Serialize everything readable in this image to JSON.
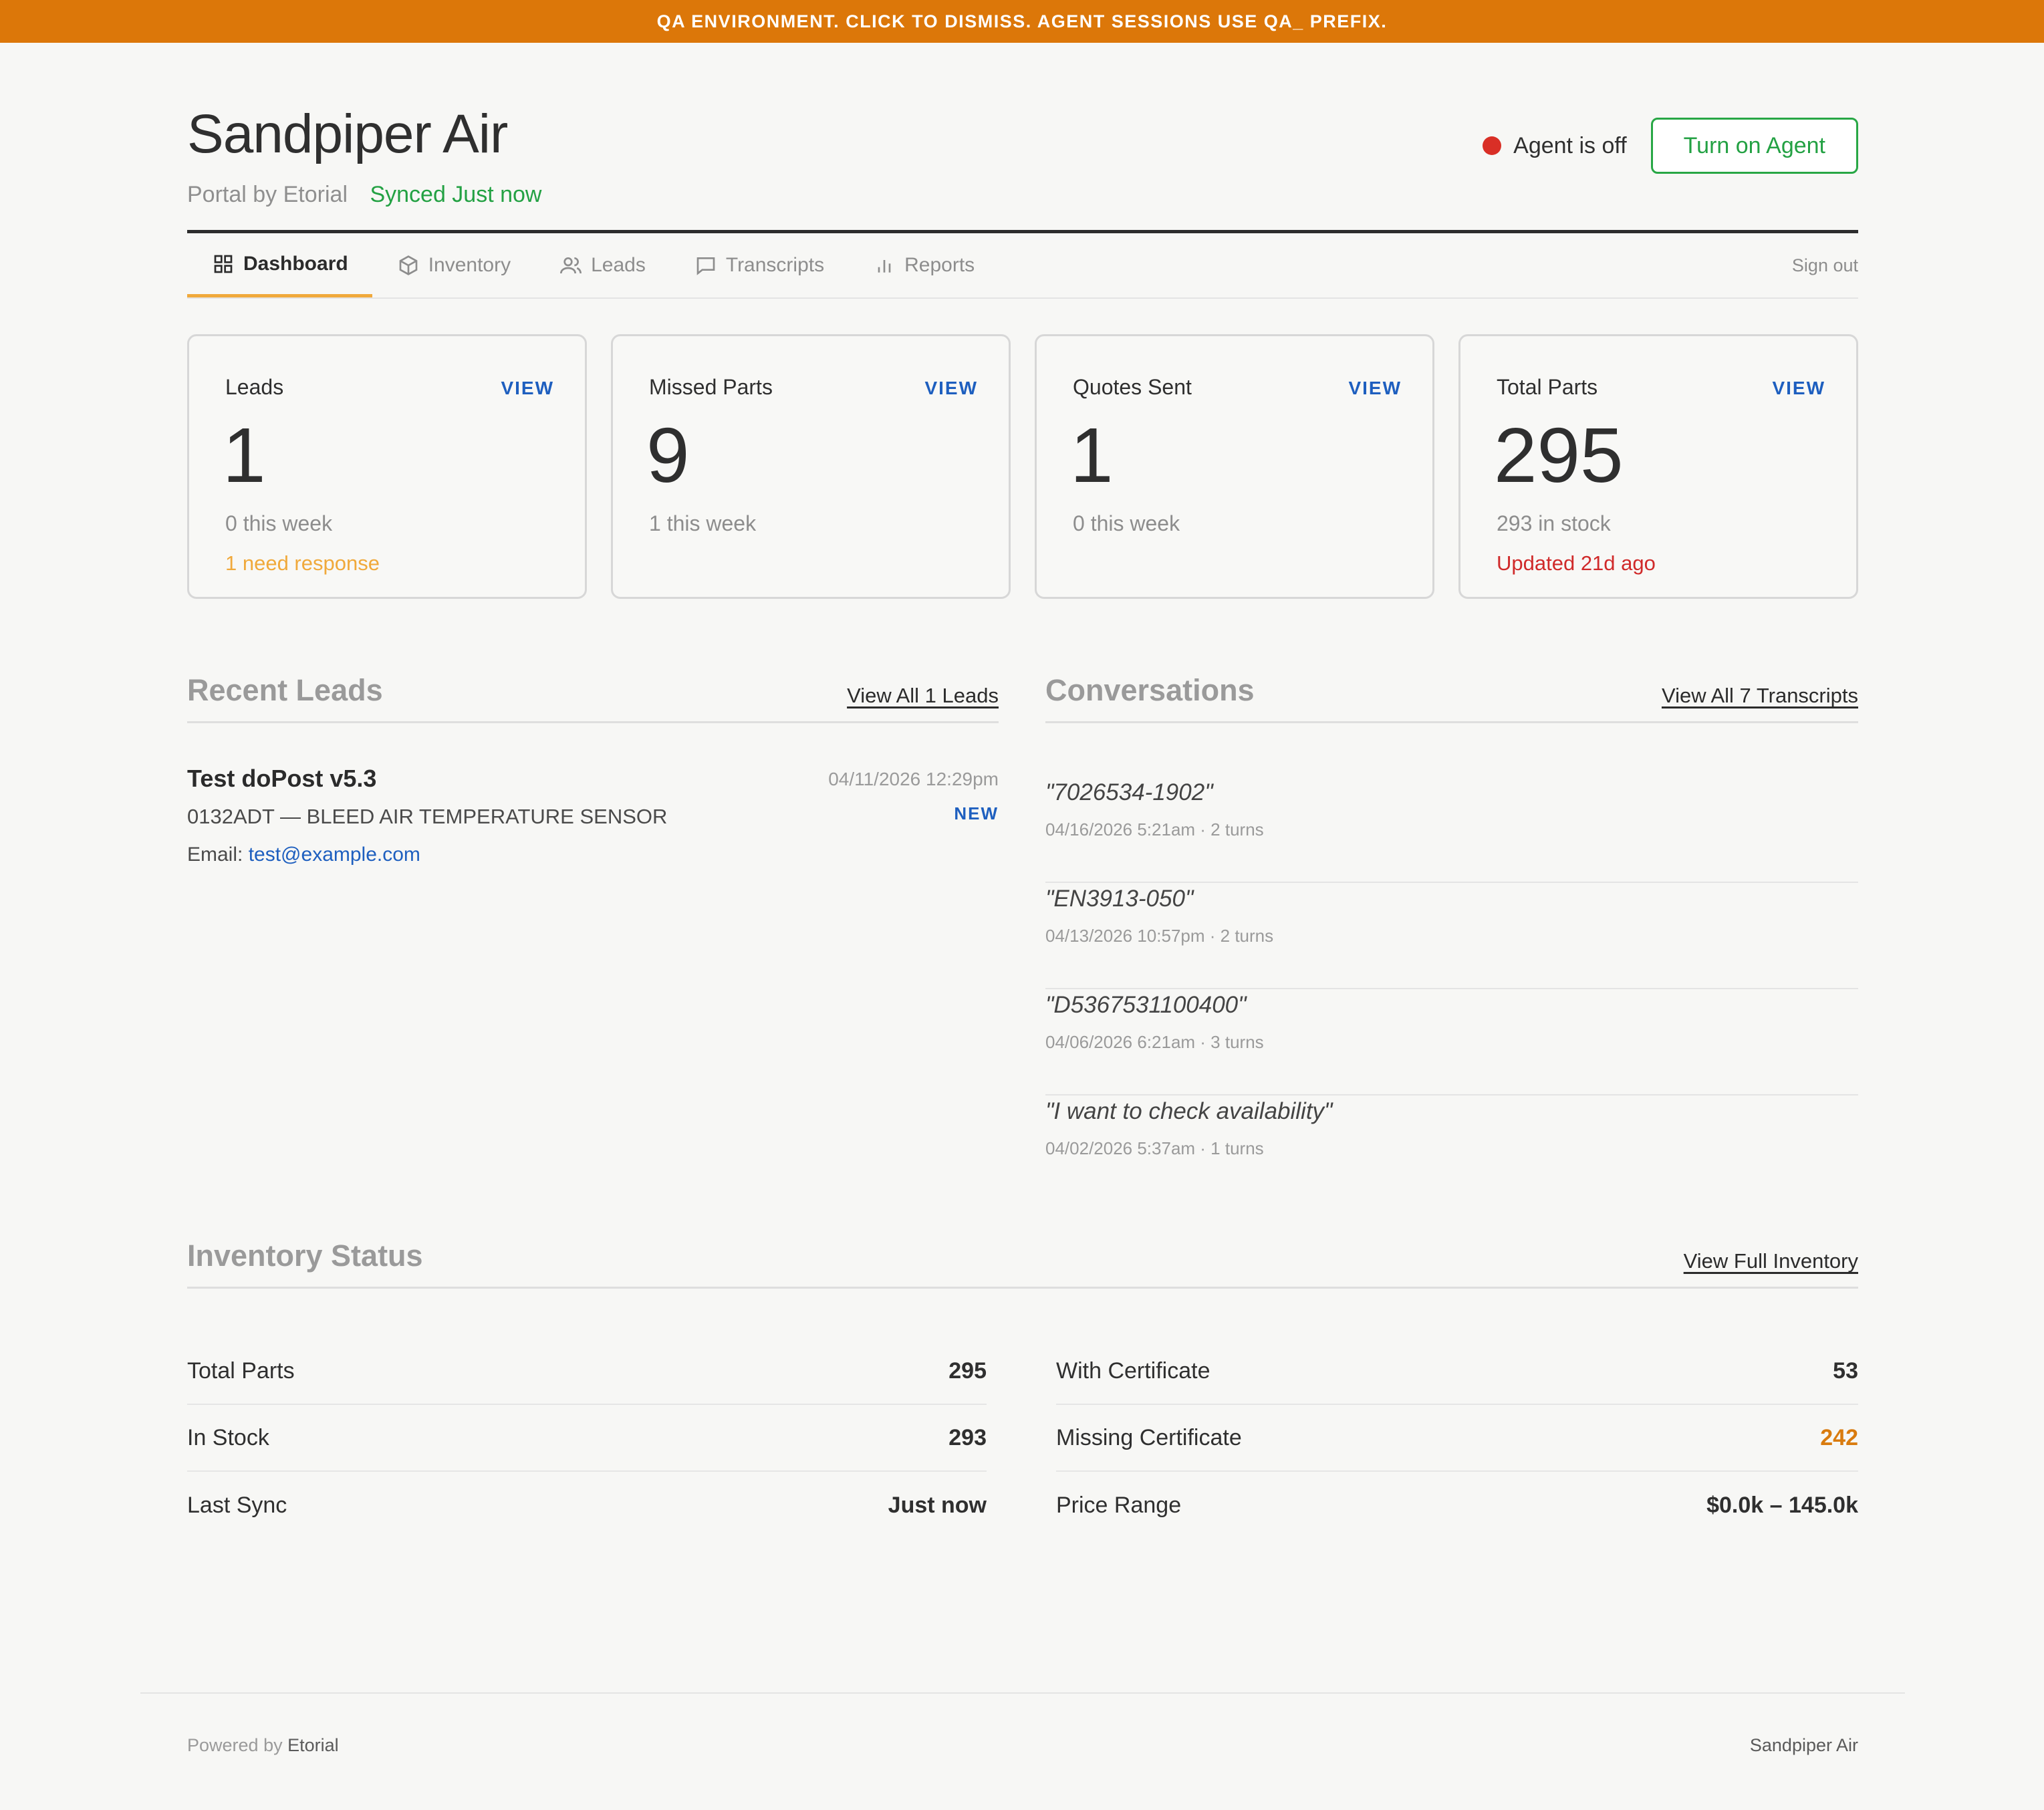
{
  "banner": {
    "text": "QA ENVIRONMENT. CLICK TO DISMISS. AGENT SESSIONS USE QA_ PREFIX."
  },
  "header": {
    "title": "Sandpiper Air",
    "portal": "Portal by Etorial",
    "synced": "Synced Just now",
    "agent_status": "Agent is off",
    "agent_button": "Turn on Agent"
  },
  "nav": {
    "tabs": [
      {
        "label": "Dashboard",
        "icon": "grid-icon",
        "active": true
      },
      {
        "label": "Inventory",
        "icon": "box-icon"
      },
      {
        "label": "Leads",
        "icon": "users-icon"
      },
      {
        "label": "Transcripts",
        "icon": "chat-icon"
      },
      {
        "label": "Reports",
        "icon": "bar-chart-icon"
      }
    ],
    "signout": "Sign out"
  },
  "cards": [
    {
      "label": "Leads",
      "view": "VIEW",
      "value": "1",
      "sub": "0 this week",
      "note": "1 need response"
    },
    {
      "label": "Missed Parts",
      "view": "VIEW",
      "value": "9",
      "sub": "1 this week",
      "note": ""
    },
    {
      "label": "Quotes Sent",
      "view": "VIEW",
      "value": "1",
      "sub": "0 this week",
      "note": ""
    },
    {
      "label": "Total Parts",
      "view": "VIEW",
      "value": "295",
      "sub": "293 in stock",
      "note": "Updated 21d ago"
    }
  ],
  "recent_leads": {
    "title": "Recent Leads",
    "link": "View All 1 Leads",
    "items": [
      {
        "name": "Test doPost v5.3",
        "part": "0132ADT — BLEED AIR TEMPERATURE SENSOR",
        "email_label": "Email:",
        "email": "test@example.com",
        "date": "04/11/2026 12:29pm",
        "badge": "NEW"
      }
    ]
  },
  "conversations": {
    "title": "Conversations",
    "link": "View All 7 Transcripts",
    "items": [
      {
        "quote": "\"7026534-1902\"",
        "meta": "04/16/2026 5:21am · 2 turns"
      },
      {
        "quote": "\"EN3913-050\"",
        "meta": "04/13/2026 10:57pm · 2 turns"
      },
      {
        "quote": "\"D5367531100400\"",
        "meta": "04/06/2026 6:21am · 3 turns"
      },
      {
        "quote": "\"I want to check availability\"",
        "meta": "04/02/2026 5:37am · 1 turns"
      }
    ]
  },
  "inventory": {
    "title": "Inventory Status",
    "link": "View Full Inventory",
    "left": [
      {
        "k": "Total Parts",
        "v": "295"
      },
      {
        "k": "In Stock",
        "v": "293"
      },
      {
        "k": "Last Sync",
        "v": "Just now"
      }
    ],
    "right": [
      {
        "k": "With Certificate",
        "v": "53"
      },
      {
        "k": "Missing Certificate",
        "v": "242"
      },
      {
        "k": "Price Range",
        "v": "$0.0k – 145.0k"
      }
    ]
  },
  "footer": {
    "powered_prefix": "Powered by",
    "powered_brand": "Etorial",
    "right": "Sandpiper Air"
  },
  "colors": {
    "banner": "#dc7709",
    "accent_green": "#23a143",
    "link_blue": "#1e5fbf",
    "amber": "#f0a93b",
    "alert_red": "#d02a2a"
  }
}
